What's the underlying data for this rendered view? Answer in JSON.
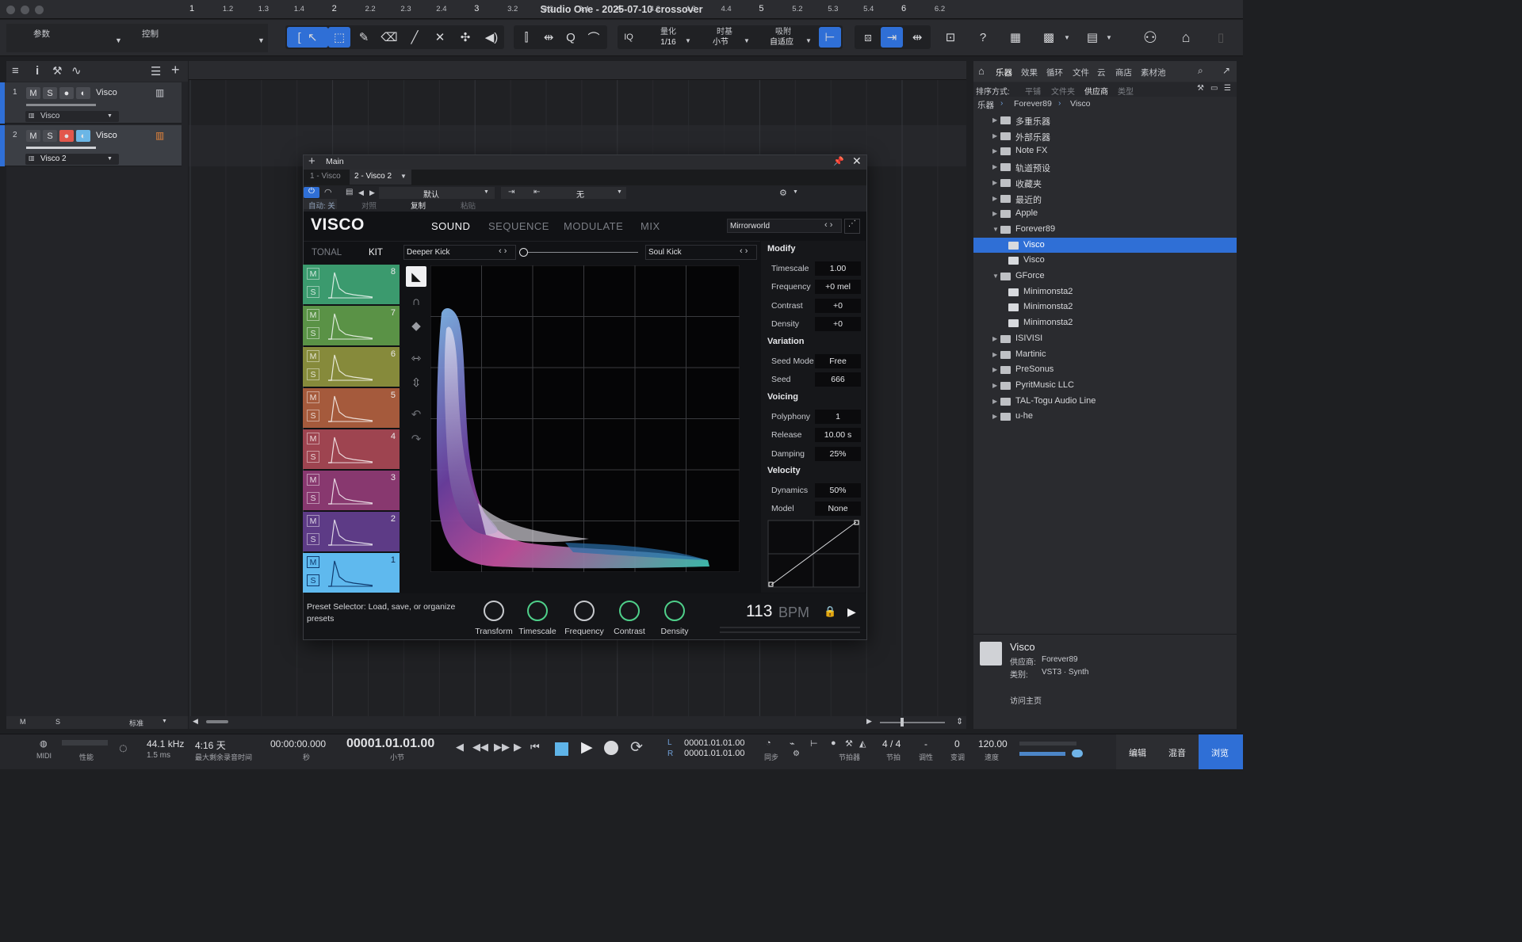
{
  "window": {
    "title": "Studio One - 2025-07-10 crossover"
  },
  "toolbar": {
    "param_label": "参数",
    "control_label": "控制",
    "iq": "IQ",
    "quantize_label": "量化",
    "quantize_value": "1/16",
    "timebase_label": "时基",
    "timebase_value": "小节",
    "snap_label": "吸附",
    "snap_value": "自适应"
  },
  "ruler": {
    "marks": [
      "1",
      "1.2",
      "1.3",
      "1.4",
      "2",
      "2.2",
      "2.3",
      "2.4",
      "3",
      "3.2",
      "3.3",
      "3.4",
      "4",
      "4.2",
      "4.3",
      "4.4",
      "5",
      "5.2",
      "5.3",
      "5.4",
      "6",
      "6.2"
    ]
  },
  "tracks": [
    {
      "num": "1",
      "mute": "M",
      "solo": "S",
      "name": "Visco",
      "instrument": "Visco"
    },
    {
      "num": "2",
      "mute": "M",
      "solo": "S",
      "name": "Visco",
      "instrument": "Visco 2"
    }
  ],
  "track_footer": {
    "m": "M",
    "s": "S",
    "mode": "标准"
  },
  "plugin": {
    "header": "Main",
    "inst_tabs": [
      "1 - Visco",
      "2 - Visco 2"
    ],
    "auto_label": "自动: 关",
    "compare_label": "对照",
    "copy_label": "复制",
    "paste_label": "粘贴",
    "preset_default": "默认",
    "sidechain_none": "无",
    "logo": "VISCO",
    "tabs": [
      "SOUND",
      "SEQUENCE",
      "MODULATE",
      "MIX"
    ],
    "active_tab": "SOUND",
    "preset_name": "Mirrorworld",
    "mode_tabs": [
      "TONAL",
      "KIT"
    ],
    "morph_left": "Deeper Kick",
    "morph_right": "Soul Kick",
    "pads": [
      {
        "n": "8",
        "color": "#3b9a6e"
      },
      {
        "n": "7",
        "color": "#5a9246"
      },
      {
        "n": "6",
        "color": "#868a3b"
      },
      {
        "n": "5",
        "color": "#a55a3c"
      },
      {
        "n": "4",
        "color": "#9e4450"
      },
      {
        "n": "3",
        "color": "#88386f"
      },
      {
        "n": "2",
        "color": "#5d3b86"
      },
      {
        "n": "1",
        "color": "#5fb9ee"
      }
    ],
    "pad_m": "M",
    "pad_s": "S",
    "modify": {
      "title": "Modify",
      "params": [
        {
          "label": "Timescale",
          "value": "1.00"
        },
        {
          "label": "Frequency",
          "value": "+0 mel"
        },
        {
          "label": "Contrast",
          "value": "+0"
        },
        {
          "label": "Density",
          "value": "+0"
        }
      ]
    },
    "variation": {
      "title": "Variation",
      "params": [
        {
          "label": "Seed Mode",
          "value": "Free"
        },
        {
          "label": "Seed",
          "value": "666"
        }
      ]
    },
    "voicing": {
      "title": "Voicing",
      "params": [
        {
          "label": "Polyphony",
          "value": "1"
        },
        {
          "label": "Release",
          "value": "10.00 s"
        },
        {
          "label": "Damping",
          "value": "25%"
        }
      ]
    },
    "velocity": {
      "title": "Velocity",
      "params": [
        {
          "label": "Dynamics",
          "value": "50%"
        },
        {
          "label": "Model",
          "value": "None"
        }
      ]
    },
    "hint": "Preset Selector: Load, save, or organize presets",
    "knobs": [
      "Transform",
      "Timescale",
      "Frequency",
      "Contrast",
      "Density"
    ],
    "bpm_value": "113",
    "bpm_unit": "BPM"
  },
  "browser": {
    "tabs": [
      "乐器",
      "效果",
      "循环",
      "文件",
      "云",
      "商店",
      "素材池"
    ],
    "sort_label": "排序方式:",
    "sort_opts": [
      "平铺",
      "文件夹",
      "供应商",
      "类型"
    ],
    "crumbs": [
      "乐器",
      "Forever89",
      "Visco"
    ],
    "items": [
      {
        "t": "多重乐器",
        "lvl": 0
      },
      {
        "t": "外部乐器",
        "lvl": 0
      },
      {
        "t": "Note FX",
        "lvl": 0
      },
      {
        "t": "轨道预设",
        "lvl": 0
      },
      {
        "t": "收藏夹",
        "lvl": 0
      },
      {
        "t": "最近的",
        "lvl": 0
      },
      {
        "t": "Apple",
        "lvl": 0
      },
      {
        "t": "Forever89",
        "lvl": 0,
        "open": true
      },
      {
        "t": "Visco",
        "lvl": 1,
        "sel": true
      },
      {
        "t": "Visco",
        "lvl": 1
      },
      {
        "t": "GForce",
        "lvl": 0,
        "open": true
      },
      {
        "t": "Minimonsta2",
        "lvl": 1
      },
      {
        "t": "Minimonsta2",
        "lvl": 1
      },
      {
        "t": "Minimonsta2",
        "lvl": 1
      },
      {
        "t": "ISIVISI",
        "lvl": 0
      },
      {
        "t": "Martinic",
        "lvl": 0
      },
      {
        "t": "PreSonus",
        "lvl": 0
      },
      {
        "t": "PyritMusic LLC",
        "lvl": 0
      },
      {
        "t": "TAL-Togu Audio Line",
        "lvl": 0
      },
      {
        "t": "u-he",
        "lvl": 0
      }
    ],
    "info": {
      "name": "Visco",
      "vendor_label": "供应商:",
      "vendor": "Forever89",
      "cat_label": "类别:",
      "cat": "VST3 · Synth",
      "home": "访问主页"
    }
  },
  "transport": {
    "midi": "MIDI",
    "perf": "性能",
    "rate": "44.1 kHz",
    "latency": "1.5 ms",
    "remain": "4:16 天",
    "remain_label": "最大剩余录音时间",
    "time": "00:00:00.000",
    "time_unit": "秒",
    "bars": "00001.01.01.00",
    "bars_unit": "小节",
    "loop_l": "00001.01.01.00",
    "loop_r": "00001.01.01.00",
    "l": "L",
    "r": "R",
    "sync": "同步",
    "metro": "节拍器",
    "sig": "4 / 4",
    "sig_label": "节拍",
    "key": "-",
    "key_label": "调性",
    "shift": "0",
    "shift_label": "变调",
    "tempo": "120.00",
    "tempo_label": "速度",
    "edit": "编辑",
    "mix": "混音",
    "browse": "浏览"
  }
}
